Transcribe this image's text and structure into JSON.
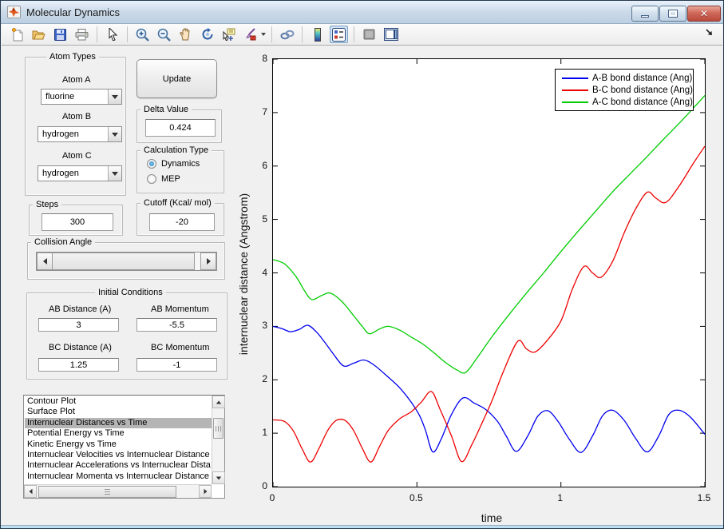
{
  "window": {
    "title": "Molecular Dynamics"
  },
  "titlebar": {
    "buttons": [
      "minimize",
      "maximize",
      "close"
    ]
  },
  "toolbar": {
    "icons": [
      "new-figure",
      "open-file",
      "save-figure",
      "print-figure",
      "edit-plot-arrow",
      "zoom-in",
      "zoom-out",
      "pan-hand",
      "rotate-3d",
      "data-cursor",
      "brush-data",
      "link-plot",
      "insert-colorbar",
      "insert-legend",
      "hide-plot-tools",
      "show-plot-tools-dock",
      "dock-figure-arrow"
    ],
    "active_icon": "insert-legend"
  },
  "controls": {
    "atom_types": {
      "title": "Atom Types",
      "atom_a_label": "Atom A",
      "atom_a_value": "fluorine",
      "atom_b_label": "Atom B",
      "atom_b_value": "hydrogen",
      "atom_c_label": "Atom C",
      "atom_c_value": "hydrogen"
    },
    "update_button": "Update",
    "delta": {
      "title": "Delta Value",
      "value": "0.424"
    },
    "calculation": {
      "title": "Calculation Type",
      "options": [
        {
          "label": "Dynamics",
          "selected": true
        },
        {
          "label": "MEP",
          "selected": false
        }
      ]
    },
    "steps": {
      "title": "Steps",
      "value": "300"
    },
    "cutoff": {
      "title": "Cutoff (Kcal/ mol)",
      "value": "-20"
    },
    "collision": {
      "title": "Collision Angle"
    },
    "initial_conditions": {
      "title": "Initial Conditions",
      "fields": [
        {
          "label": "AB Distance (A)",
          "value": "3"
        },
        {
          "label": "AB Momentum",
          "value": "-5.5"
        },
        {
          "label": "BC Distance (A)",
          "value": "1.25"
        },
        {
          "label": "BC Momentum",
          "value": "-1"
        }
      ]
    },
    "listbox": {
      "selected_index": 2,
      "items": [
        "Contour Plot",
        "Surface Plot",
        "Internuclear Distances vs Time",
        "Potential Energy vs Time",
        "Kinetic Energy vs Time",
        "Internuclear Velocities vs Internuclear Distance",
        "Internuclear Accelerations vs Internuclear Dista",
        "Internuclear Momenta vs Internuclear Distance"
      ]
    }
  },
  "chart_data": {
    "type": "line",
    "title": "",
    "xlabel": "time",
    "ylabel": "internuclear distance (Angstrom)",
    "xlim": [
      0,
      1.5
    ],
    "ylim": [
      0,
      8
    ],
    "x_ticks": [
      0,
      0.5,
      1,
      1.5
    ],
    "x_tick_labels": [
      "0",
      "0.5",
      "1",
      "1.5"
    ],
    "y_ticks": [
      0,
      1,
      2,
      3,
      4,
      5,
      6,
      7,
      8
    ],
    "grid": false,
    "legend_position": "top-right",
    "series": [
      {
        "name": "A-B bond distance (Ang)",
        "color": "#0000ee",
        "points": [
          [
            0,
            3.0
          ],
          [
            0.03,
            2.96
          ],
          [
            0.06,
            2.9
          ],
          [
            0.09,
            2.94
          ],
          [
            0.12,
            3.02
          ],
          [
            0.15,
            2.9
          ],
          [
            0.18,
            2.7
          ],
          [
            0.21,
            2.48
          ],
          [
            0.245,
            2.26
          ],
          [
            0.28,
            2.31
          ],
          [
            0.315,
            2.37
          ],
          [
            0.35,
            2.28
          ],
          [
            0.4,
            2.05
          ],
          [
            0.44,
            1.85
          ],
          [
            0.48,
            1.58
          ],
          [
            0.51,
            1.32
          ],
          [
            0.53,
            1.05
          ],
          [
            0.555,
            0.65
          ],
          [
            0.585,
            0.9
          ],
          [
            0.62,
            1.35
          ],
          [
            0.66,
            1.66
          ],
          [
            0.7,
            1.56
          ],
          [
            0.74,
            1.44
          ],
          [
            0.78,
            1.22
          ],
          [
            0.81,
            0.95
          ],
          [
            0.845,
            0.66
          ],
          [
            0.885,
            0.95
          ],
          [
            0.92,
            1.32
          ],
          [
            0.955,
            1.42
          ],
          [
            0.99,
            1.22
          ],
          [
            1.03,
            0.88
          ],
          [
            1.07,
            0.64
          ],
          [
            1.11,
            0.95
          ],
          [
            1.145,
            1.33
          ],
          [
            1.18,
            1.43
          ],
          [
            1.22,
            1.24
          ],
          [
            1.26,
            0.9
          ],
          [
            1.3,
            0.65
          ],
          [
            1.34,
            0.95
          ],
          [
            1.375,
            1.35
          ],
          [
            1.41,
            1.43
          ],
          [
            1.45,
            1.3
          ],
          [
            1.5,
            0.98
          ]
        ]
      },
      {
        "name": "B-C bond distance (Ang)",
        "color": "#ee0000",
        "points": [
          [
            0,
            1.25
          ],
          [
            0.04,
            1.22
          ],
          [
            0.07,
            1.05
          ],
          [
            0.1,
            0.72
          ],
          [
            0.13,
            0.46
          ],
          [
            0.16,
            0.72
          ],
          [
            0.19,
            1.05
          ],
          [
            0.22,
            1.24
          ],
          [
            0.25,
            1.24
          ],
          [
            0.28,
            1.05
          ],
          [
            0.31,
            0.72
          ],
          [
            0.34,
            0.46
          ],
          [
            0.37,
            0.75
          ],
          [
            0.4,
            1.05
          ],
          [
            0.44,
            1.27
          ],
          [
            0.48,
            1.4
          ],
          [
            0.515,
            1.58
          ],
          [
            0.55,
            1.78
          ],
          [
            0.58,
            1.45
          ],
          [
            0.62,
            0.95
          ],
          [
            0.655,
            0.47
          ],
          [
            0.69,
            0.78
          ],
          [
            0.72,
            1.12
          ],
          [
            0.76,
            1.6
          ],
          [
            0.8,
            2.15
          ],
          [
            0.85,
            2.72
          ],
          [
            0.88,
            2.58
          ],
          [
            0.91,
            2.52
          ],
          [
            0.95,
            2.72
          ],
          [
            1.0,
            3.1
          ],
          [
            1.04,
            3.7
          ],
          [
            1.08,
            4.12
          ],
          [
            1.11,
            4.0
          ],
          [
            1.14,
            3.92
          ],
          [
            1.18,
            4.22
          ],
          [
            1.22,
            4.75
          ],
          [
            1.26,
            5.2
          ],
          [
            1.3,
            5.51
          ],
          [
            1.33,
            5.4
          ],
          [
            1.365,
            5.32
          ],
          [
            1.41,
            5.62
          ],
          [
            1.46,
            6.05
          ],
          [
            1.5,
            6.37
          ]
        ]
      },
      {
        "name": "A-C bond distance (Ang)",
        "color": "#00cc00",
        "points": [
          [
            0,
            4.25
          ],
          [
            0.04,
            4.17
          ],
          [
            0.08,
            3.93
          ],
          [
            0.11,
            3.66
          ],
          [
            0.135,
            3.5
          ],
          [
            0.17,
            3.58
          ],
          [
            0.2,
            3.62
          ],
          [
            0.24,
            3.46
          ],
          [
            0.28,
            3.2
          ],
          [
            0.31,
            3.0
          ],
          [
            0.335,
            2.86
          ],
          [
            0.37,
            2.95
          ],
          [
            0.4,
            3.0
          ],
          [
            0.44,
            2.93
          ],
          [
            0.48,
            2.8
          ],
          [
            0.52,
            2.67
          ],
          [
            0.56,
            2.5
          ],
          [
            0.6,
            2.32
          ],
          [
            0.64,
            2.18
          ],
          [
            0.67,
            2.14
          ],
          [
            0.71,
            2.42
          ],
          [
            0.76,
            2.8
          ],
          [
            0.82,
            3.22
          ],
          [
            0.88,
            3.62
          ],
          [
            0.94,
            4.0
          ],
          [
            1.0,
            4.4
          ],
          [
            1.06,
            4.78
          ],
          [
            1.12,
            5.15
          ],
          [
            1.18,
            5.52
          ],
          [
            1.24,
            5.85
          ],
          [
            1.3,
            6.18
          ],
          [
            1.36,
            6.52
          ],
          [
            1.42,
            6.85
          ],
          [
            1.5,
            7.32
          ]
        ]
      }
    ]
  }
}
